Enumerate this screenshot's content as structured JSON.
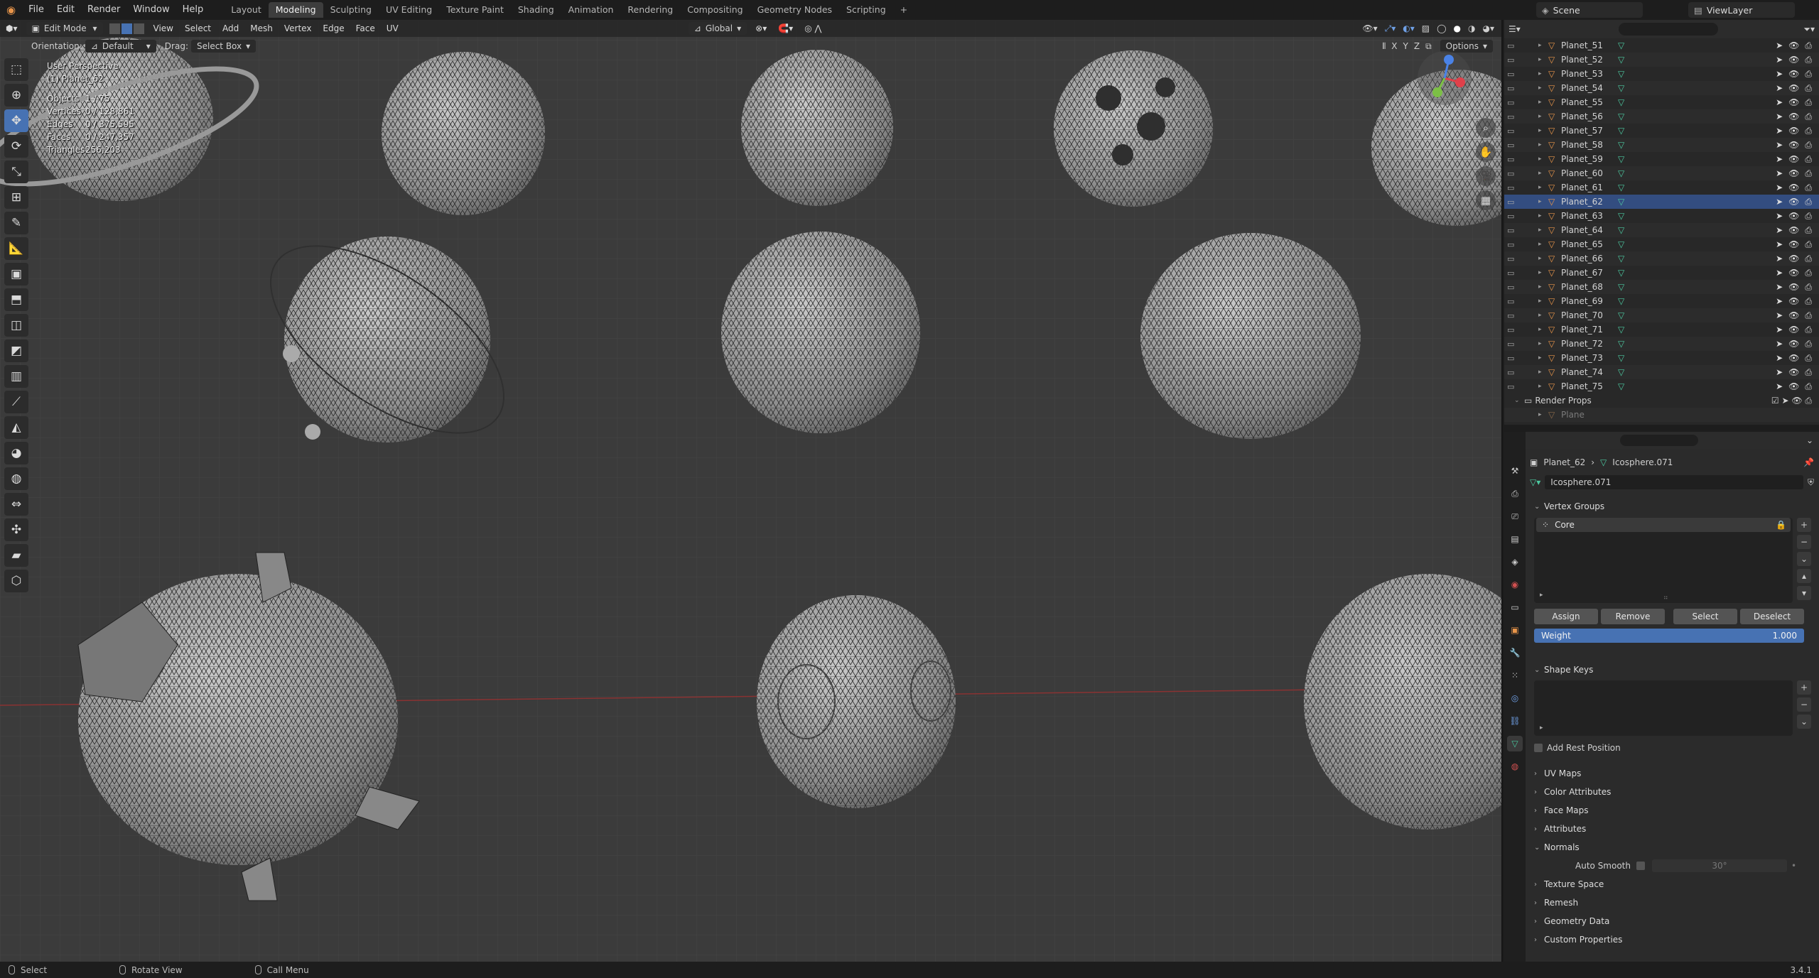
{
  "topbar": {
    "menus": [
      "File",
      "Edit",
      "Render",
      "Window",
      "Help"
    ],
    "workspaces": [
      "Layout",
      "Modeling",
      "Sculpting",
      "UV Editing",
      "Texture Paint",
      "Shading",
      "Animation",
      "Rendering",
      "Compositing",
      "Geometry Nodes",
      "Scripting"
    ],
    "active_workspace": "Modeling",
    "scene": "Scene",
    "view_layer": "ViewLayer"
  },
  "viewport": {
    "mode": "Edit Mode",
    "menus": [
      "View",
      "Select",
      "Add",
      "Mesh",
      "Vertex",
      "Edge",
      "Face",
      "UV"
    ],
    "transform_orientation": "Global",
    "orientation_label": "Orientation:",
    "orientation_value": "Default",
    "drag_label": "Drag:",
    "drag_value": "Select Box",
    "options_label": "Options",
    "axis_labels": [
      "X",
      "Y",
      "Z"
    ],
    "view_name": "User Perspective",
    "active_object": "(1) Planet_62",
    "stats": [
      {
        "key": "Objects",
        "value": "1 / 75"
      },
      {
        "key": "Vertices",
        "value": "0 / 128,861"
      },
      {
        "key": "Edges",
        "value": "0 / 375,595"
      },
      {
        "key": "Faces",
        "value": "0 / 247,357"
      },
      {
        "key": "Triangles",
        "value": "256,203"
      }
    ],
    "gizmo_colors": {
      "x": "#e0404a",
      "y": "#7cc045",
      "z": "#4a82e6"
    }
  },
  "outliner": {
    "rows": [
      {
        "name": "Planet_51",
        "selected": false
      },
      {
        "name": "Planet_52",
        "selected": false
      },
      {
        "name": "Planet_53",
        "selected": false
      },
      {
        "name": "Planet_54",
        "selected": false
      },
      {
        "name": "Planet_55",
        "selected": false
      },
      {
        "name": "Planet_56",
        "selected": false
      },
      {
        "name": "Planet_57",
        "selected": false
      },
      {
        "name": "Planet_58",
        "selected": false
      },
      {
        "name": "Planet_59",
        "selected": false
      },
      {
        "name": "Planet_60",
        "selected": false
      },
      {
        "name": "Planet_61",
        "selected": false
      },
      {
        "name": "Planet_62",
        "selected": true
      },
      {
        "name": "Planet_63",
        "selected": false
      },
      {
        "name": "Planet_64",
        "selected": false
      },
      {
        "name": "Planet_65",
        "selected": false
      },
      {
        "name": "Planet_66",
        "selected": false
      },
      {
        "name": "Planet_67",
        "selected": false
      },
      {
        "name": "Planet_68",
        "selected": false
      },
      {
        "name": "Planet_69",
        "selected": false
      },
      {
        "name": "Planet_70",
        "selected": false
      },
      {
        "name": "Planet_71",
        "selected": false
      },
      {
        "name": "Planet_72",
        "selected": false
      },
      {
        "name": "Planet_73",
        "selected": false
      },
      {
        "name": "Planet_74",
        "selected": false
      },
      {
        "name": "Planet_75",
        "selected": false
      }
    ],
    "collection": "Render Props",
    "collection_child": "Plane"
  },
  "properties": {
    "breadcrumb_object": "Planet_62",
    "breadcrumb_data": "Icosphere.071",
    "data_name": "Icosphere.071",
    "vertex_groups_label": "Vertex Groups",
    "vertex_group_items": [
      "Core"
    ],
    "assign_label": "Assign",
    "remove_label": "Remove",
    "select_label": "Select",
    "deselect_label": "Deselect",
    "weight_label": "Weight",
    "weight_value": "1.000",
    "shape_keys_label": "Shape Keys",
    "add_rest_position_label": "Add Rest Position",
    "uv_maps_label": "UV Maps",
    "color_attributes_label": "Color Attributes",
    "face_maps_label": "Face Maps",
    "attributes_label": "Attributes",
    "normals_label": "Normals",
    "auto_smooth_label": "Auto Smooth",
    "auto_smooth_angle": "30°",
    "texture_space_label": "Texture Space",
    "remesh_label": "Remesh",
    "geometry_data_label": "Geometry Data",
    "custom_properties_label": "Custom Properties"
  },
  "statusbar": {
    "items": [
      "Select",
      "Rotate View",
      "Call Menu"
    ],
    "version": "3.4.1"
  }
}
